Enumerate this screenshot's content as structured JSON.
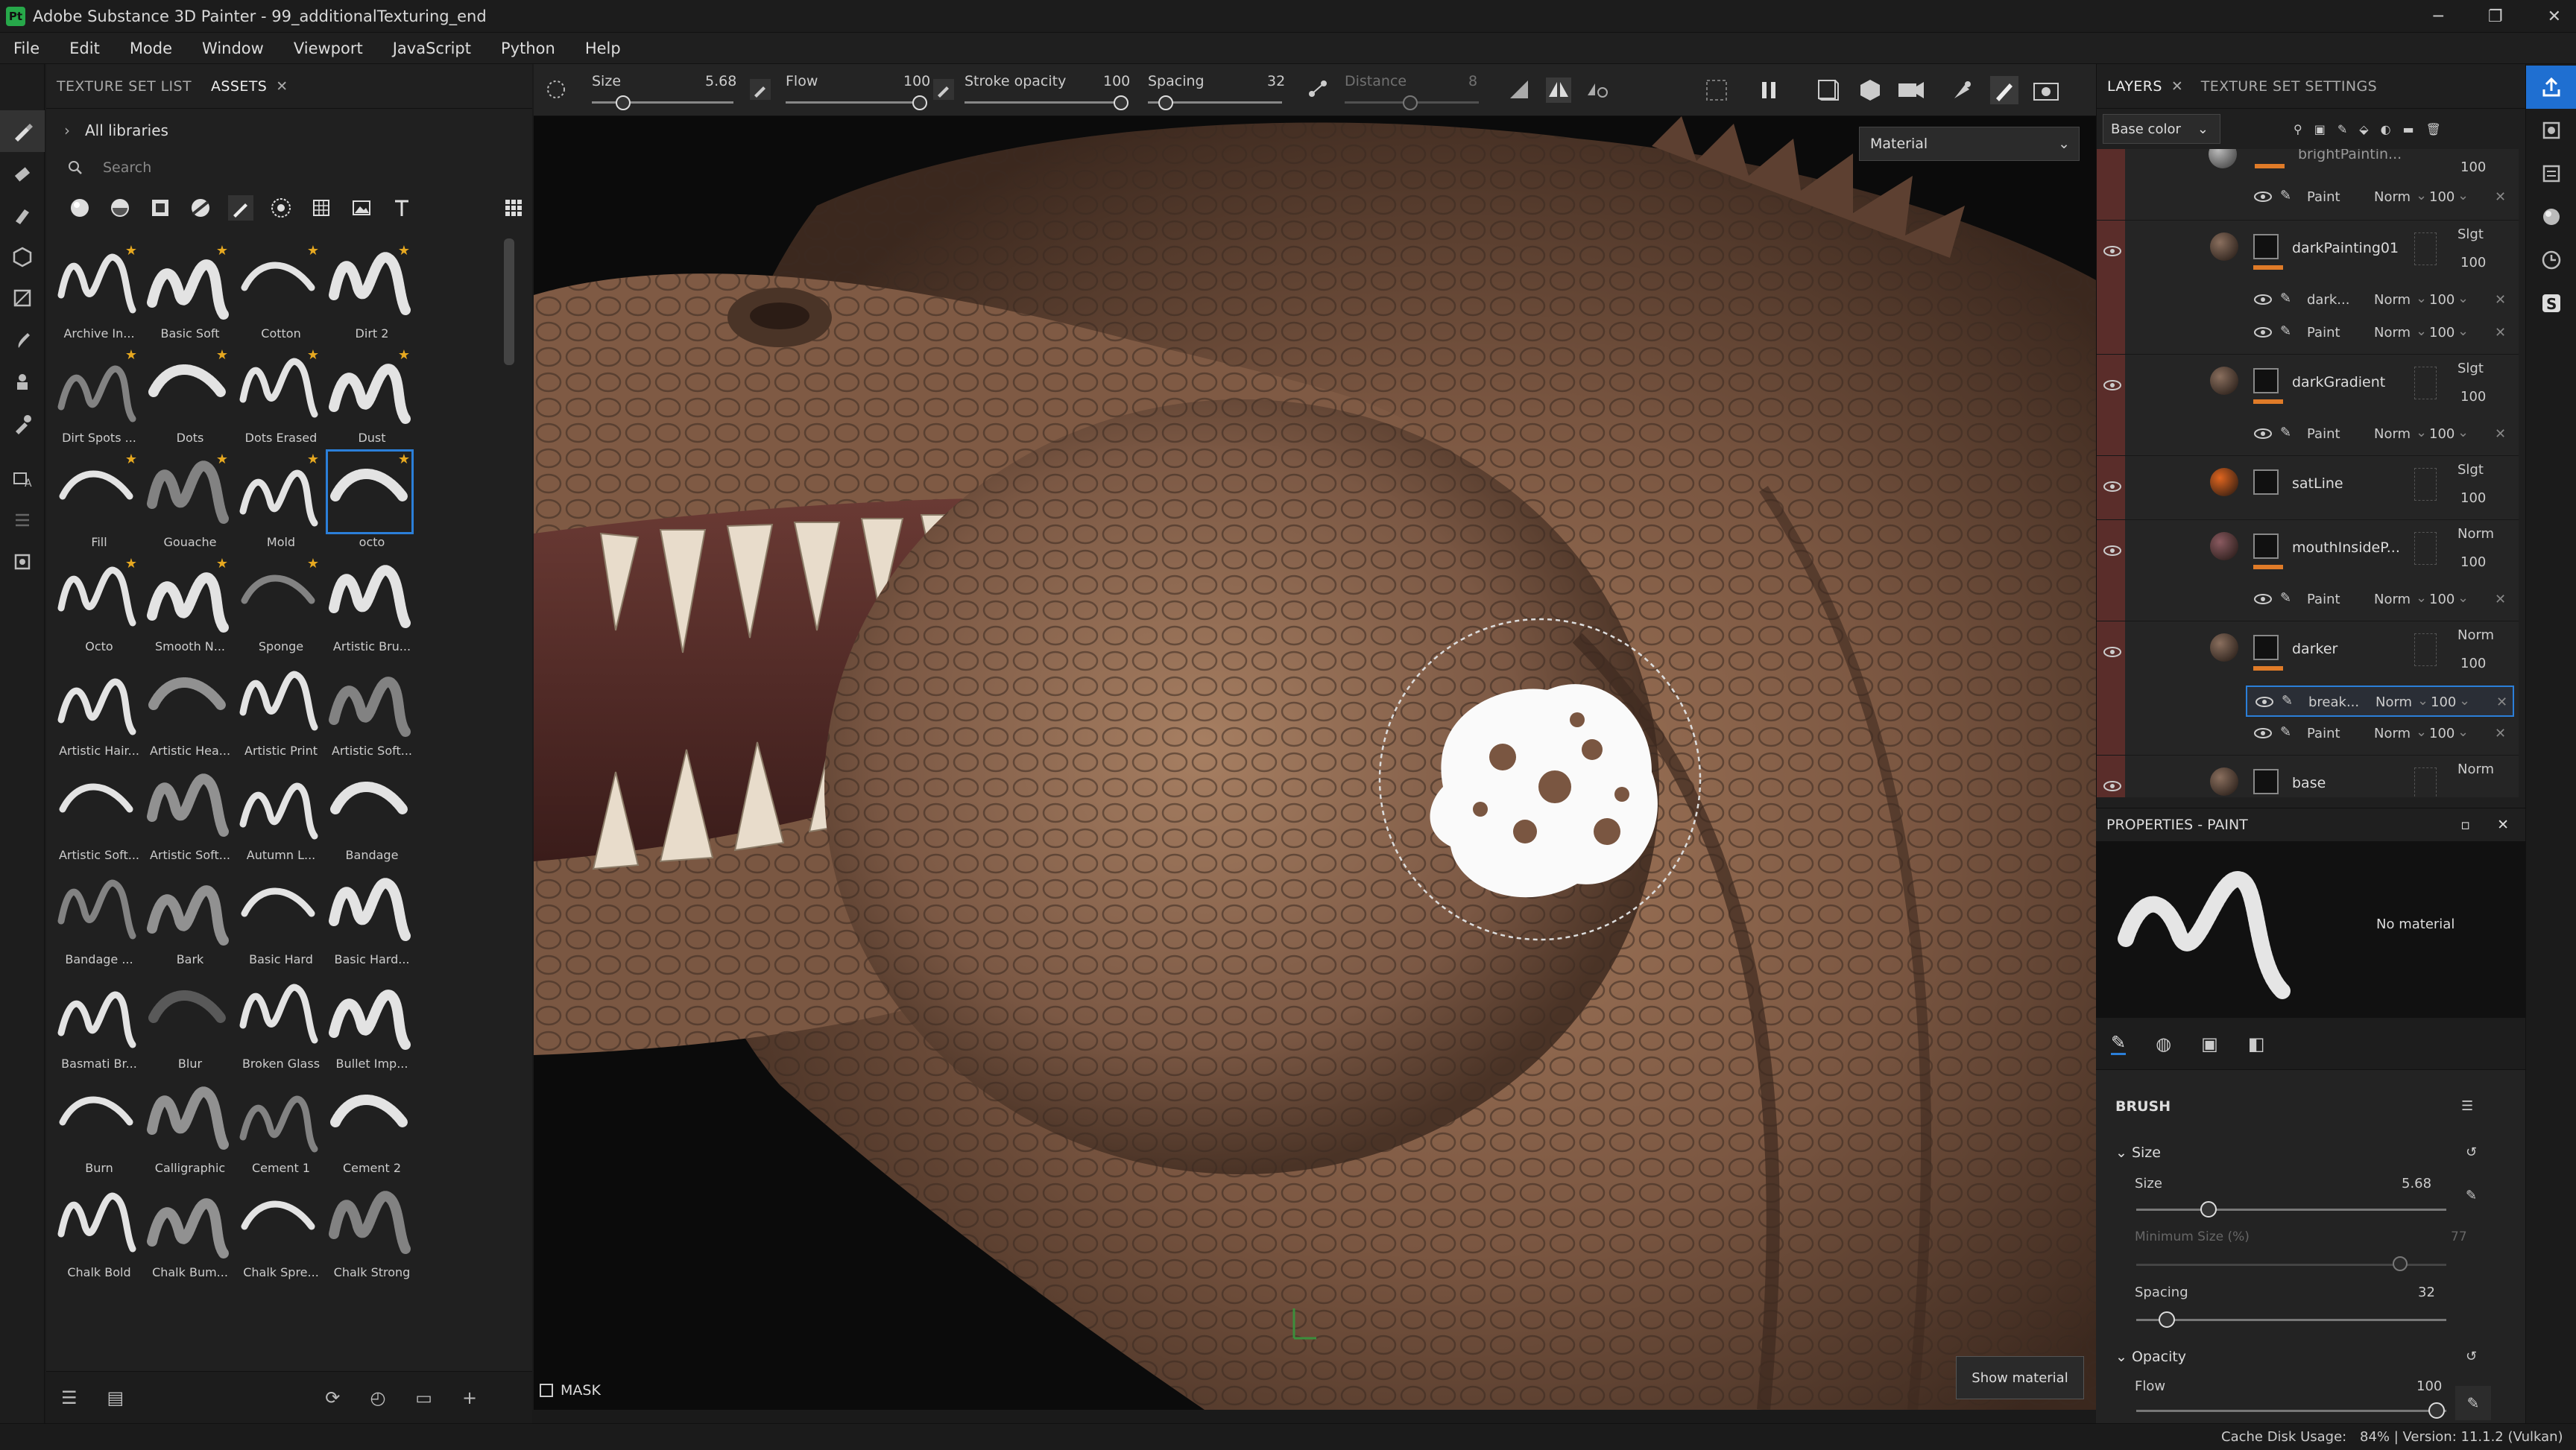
{
  "window": {
    "app_icon": "Pt",
    "title": "Adobe Substance 3D Painter - 99_additionalTexturing_end",
    "controls": [
      "─",
      "❐",
      "✕"
    ]
  },
  "menu": [
    "File",
    "Edit",
    "Mode",
    "Window",
    "Viewport",
    "JavaScript",
    "Python",
    "Help"
  ],
  "assets_panel": {
    "tabs": [
      "TEXTURE SET LIST",
      "ASSETS"
    ],
    "library": "All libraries",
    "search_placeholder": "Search",
    "brushes": [
      {
        "label": "Archive In...",
        "star": true
      },
      {
        "label": "Basic Soft",
        "star": true
      },
      {
        "label": "Cotton",
        "star": true
      },
      {
        "label": "Dirt 2",
        "star": true
      },
      {
        "label": "Dirt Spots ...",
        "star": true
      },
      {
        "label": "Dots",
        "star": true
      },
      {
        "label": "Dots Erased",
        "star": true
      },
      {
        "label": "Dust",
        "star": true
      },
      {
        "label": "Fill",
        "star": true
      },
      {
        "label": "Gouache",
        "star": true
      },
      {
        "label": "Mold",
        "star": true
      },
      {
        "label": "octo",
        "star": true
      },
      {
        "label": "Octo",
        "star": true
      },
      {
        "label": "Smooth N...",
        "star": true
      },
      {
        "label": "Sponge",
        "star": true
      },
      {
        "label": "Artistic Bru...",
        "star": false
      },
      {
        "label": "Artistic Hair...",
        "star": false
      },
      {
        "label": "Artistic Hea...",
        "star": false
      },
      {
        "label": "Artistic Print",
        "star": false
      },
      {
        "label": "Artistic Soft...",
        "star": false
      },
      {
        "label": "Artistic Soft...",
        "star": false
      },
      {
        "label": "Artistic Soft...",
        "star": false
      },
      {
        "label": "Autumn L...",
        "star": false
      },
      {
        "label": "Bandage",
        "star": false
      },
      {
        "label": "Bandage ...",
        "star": false
      },
      {
        "label": "Bark",
        "star": false
      },
      {
        "label": "Basic Hard",
        "star": false
      },
      {
        "label": "Basic Hard...",
        "star": false
      },
      {
        "label": "Basmati Br...",
        "star": false
      },
      {
        "label": "Blur",
        "star": false
      },
      {
        "label": "Broken Glass",
        "star": false
      },
      {
        "label": "Bullet Imp...",
        "star": false
      },
      {
        "label": "Burn",
        "star": false
      },
      {
        "label": "Calligraphic",
        "star": false
      },
      {
        "label": "Cement 1",
        "star": false
      },
      {
        "label": "Cement 2",
        "star": false
      },
      {
        "label": "Chalk Bold",
        "star": false
      },
      {
        "label": "Chalk Bum...",
        "star": false
      },
      {
        "label": "Chalk Spre...",
        "star": false
      },
      {
        "label": "Chalk Strong",
        "star": false
      }
    ],
    "selected_brush_index": 11
  },
  "toolbar": {
    "size_label": "Size",
    "size_value": "5.68",
    "flow_label": "Flow",
    "flow_value": "100",
    "opacity_label": "Stroke opacity",
    "opacity_value": "100",
    "spacing_label": "Spacing",
    "spacing_value": "32",
    "distance_label": "Distance",
    "distance_value": "8"
  },
  "viewport": {
    "material_dropdown": "Material",
    "mask_label": "MASK",
    "show_material": "Show material"
  },
  "layers_panel": {
    "tabs": [
      "LAYERS",
      "TEXTURE SET SETTINGS"
    ],
    "blend_channel": "Base color",
    "top_partial": {
      "name": "brightPaintin...",
      "value": "100"
    },
    "top_sublayer": {
      "name": "Paint",
      "blend": "Norm",
      "opacity": "100"
    },
    "layers": [
      {
        "name": "darkPainting01",
        "blend": "Slgt",
        "opacity": "100",
        "sublayers": [
          {
            "name": "dark...",
            "blend": "Norm",
            "opacity": "100"
          },
          {
            "name": "Paint",
            "blend": "Norm",
            "opacity": "100"
          }
        ]
      },
      {
        "name": "darkGradient",
        "blend": "Slgt",
        "opacity": "100",
        "sublayers": [
          {
            "name": "Paint",
            "blend": "Norm",
            "opacity": "100"
          }
        ]
      },
      {
        "name": "satLine",
        "blend": "Slgt",
        "opacity": "100",
        "sublayers": []
      },
      {
        "name": "mouthInsideP...",
        "blend": "Norm",
        "opacity": "100",
        "sublayers": [
          {
            "name": "Paint",
            "blend": "Norm",
            "opacity": "100"
          }
        ]
      },
      {
        "name": "darker",
        "blend": "Norm",
        "opacity": "100",
        "sublayers": [
          {
            "name": "break...",
            "blend": "Norm",
            "opacity": "100",
            "selected": true
          },
          {
            "name": "Paint",
            "blend": "Norm",
            "opacity": "100"
          }
        ]
      },
      {
        "name": "base",
        "blend": "Norm",
        "opacity": "",
        "sublayers": []
      }
    ]
  },
  "properties": {
    "title": "PROPERTIES - PAINT",
    "no_material": "No material",
    "section": "BRUSH",
    "size_group": "Size",
    "size_label": "Size",
    "size_value": "5.68",
    "min_size_label": "Minimum Size (%)",
    "min_size_value": "77",
    "spacing_label": "Spacing",
    "spacing_value": "32",
    "opacity_group": "Opacity",
    "flow_label": "Flow",
    "flow_value": "100"
  },
  "status": {
    "cache_label": "Cache Disk Usage:",
    "cache_value": "84% | Version: 11.1.2 (Vulkan)"
  },
  "colors": {
    "accent": "#2b7fd9",
    "orange": "#e07b28",
    "layer_red": "#5a2d2a",
    "app_green": "#27a84a"
  }
}
